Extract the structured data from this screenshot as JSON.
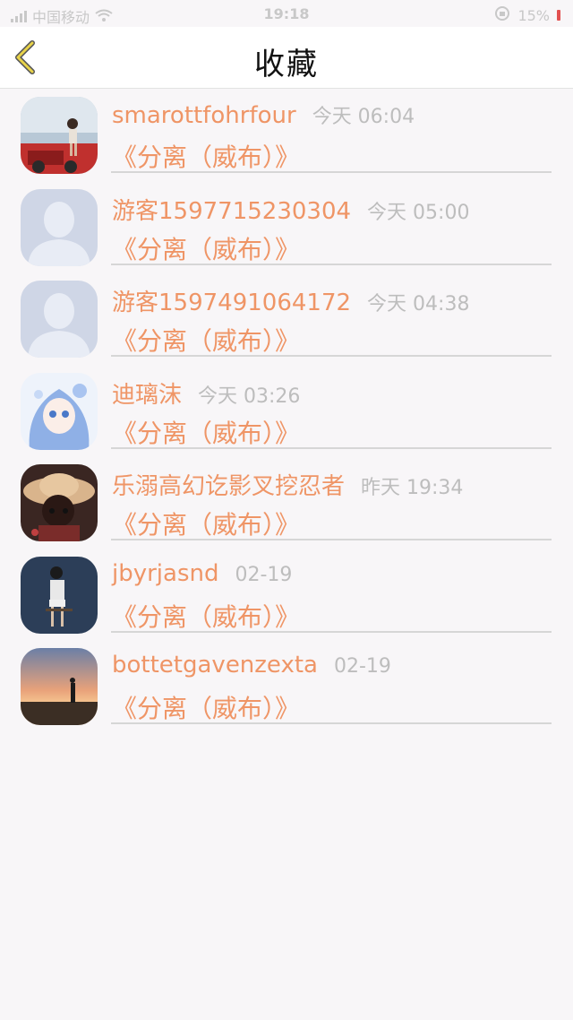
{
  "status_bar": {
    "carrier": "中国移动",
    "time": "19:18",
    "battery": "15%"
  },
  "nav": {
    "title": "收藏"
  },
  "colors": {
    "accent": "#ef9566",
    "timestamp": "#bdbdbd",
    "back_arrow": "#d8c23a"
  },
  "items": [
    {
      "user": "smarottfohrfour",
      "time": "今天 06:04",
      "song": "《分离（威布）》",
      "avatar": "photo-avatar-icon"
    },
    {
      "user": "游客1597715230304",
      "time": "今天 05:00",
      "song": "《分离（威布）》",
      "avatar": "default-person-avatar-icon"
    },
    {
      "user": "游客1597491064172",
      "time": "今天 04:38",
      "song": "《分离（威布）》",
      "avatar": "default-person-avatar-icon"
    },
    {
      "user": "迪璃沫",
      "time": "今天 03:26",
      "song": "《分离（威布）》",
      "avatar": "anime-avatar-icon"
    },
    {
      "user": "乐溺高幻讫影叉挖忍者",
      "time": "昨天 19:34",
      "song": "《分离（威布）》",
      "avatar": "doll-avatar-icon"
    },
    {
      "user": "jbyrjasnd",
      "time": "02-19",
      "song": "《分离（威布）》",
      "avatar": "photo-avatar-icon"
    },
    {
      "user": "bottetgavenzexta",
      "time": "02-19",
      "song": "《分离（威布）》",
      "avatar": "sunset-avatar-icon"
    }
  ]
}
